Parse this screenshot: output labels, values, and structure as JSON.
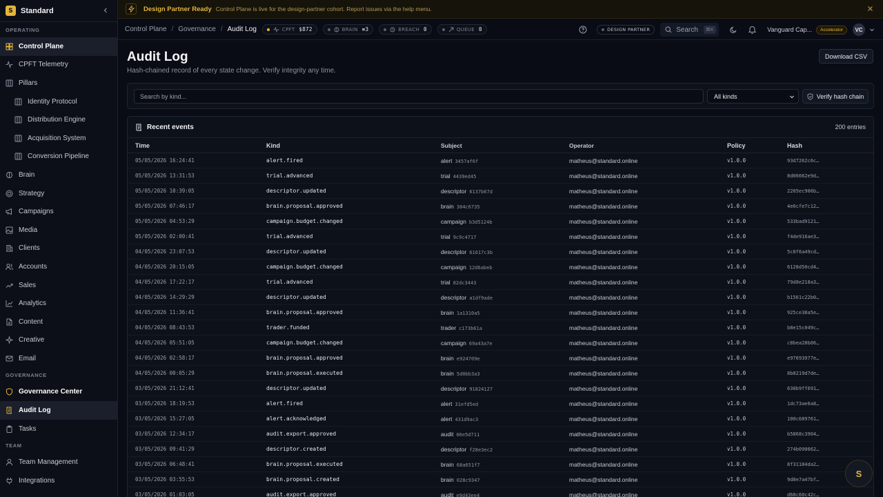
{
  "app": {
    "name": "Standard",
    "logo": "S"
  },
  "sidebar": {
    "sections": [
      {
        "label": "OPERATING",
        "items": [
          {
            "label": "Control Plane",
            "icon": "grid-icon",
            "active": true
          },
          {
            "label": "CPFT Telemetry",
            "icon": "activity-icon"
          },
          {
            "label": "Pillars",
            "icon": "columns-icon"
          },
          {
            "label": "Identity Protocol",
            "icon": "columns-icon",
            "sub": true
          },
          {
            "label": "Distribution Engine",
            "icon": "columns-icon",
            "sub": true
          },
          {
            "label": "Acquisition System",
            "icon": "columns-icon",
            "sub": true
          },
          {
            "label": "Conversion Pipeline",
            "icon": "columns-icon",
            "sub": true
          },
          {
            "label": "Brain",
            "icon": "brain-icon"
          },
          {
            "label": "Strategy",
            "icon": "target-icon"
          },
          {
            "label": "Campaigns",
            "icon": "megaphone-icon"
          },
          {
            "label": "Media",
            "icon": "image-icon"
          },
          {
            "label": "Clients",
            "icon": "building-icon"
          },
          {
            "label": "Accounts",
            "icon": "users-icon"
          },
          {
            "label": "Sales",
            "icon": "trending-icon"
          },
          {
            "label": "Analytics",
            "icon": "chart-icon"
          },
          {
            "label": "Content",
            "icon": "file-icon"
          },
          {
            "label": "Creative",
            "icon": "sparkle-icon"
          },
          {
            "label": "Email",
            "icon": "mail-icon"
          }
        ]
      },
      {
        "label": "GOVERNANCE",
        "items": [
          {
            "label": "Governance Center",
            "icon": "shield-icon",
            "active": true
          },
          {
            "label": "Audit Log",
            "icon": "scroll-icon",
            "active": true
          },
          {
            "label": "Tasks",
            "icon": "clipboard-icon"
          }
        ]
      },
      {
        "label": "TEAM",
        "items": [
          {
            "label": "Team Management",
            "icon": "user-icon"
          },
          {
            "label": "Integrations",
            "icon": "plug-icon"
          }
        ]
      }
    ]
  },
  "banner": {
    "title": "Design Partner Ready",
    "message": "Control Plane is live for the design-partner cohort. Report issues via the help menu."
  },
  "breadcrumb": [
    "Control Plane",
    "Governance",
    "Audit Log"
  ],
  "metrics": [
    {
      "label": "CPFT",
      "value": "$872"
    },
    {
      "label": "BRAIN",
      "value": "≡3"
    },
    {
      "label": "BREACH",
      "value": "0"
    },
    {
      "label": "QUEUE",
      "value": "0"
    }
  ],
  "topbar": {
    "badge": "DESIGN PARTNER",
    "search_label": "Search",
    "shortcut": "⌘K",
    "org": "Vanguard Cap...",
    "tier": "Accelerator",
    "avatar": "VC"
  },
  "page": {
    "title": "Audit Log",
    "subtitle": "Hash-chained record of every state change. Verify integrity any time.",
    "download": "Download CSV"
  },
  "filters": {
    "placeholder": "Search by kind...",
    "kind_value": "All kinds",
    "verify": "Verify hash chain"
  },
  "table": {
    "title": "Recent events",
    "count": "200 entries",
    "columns": [
      "Time",
      "Kind",
      "Subject",
      "Operator",
      "Policy",
      "Hash"
    ],
    "rows": [
      [
        "05/05/2026 16:24:41",
        "alert.fired",
        "alert",
        "3457af6f",
        "matheus@standard.online",
        "v1.0.0",
        "93d7262c6c…"
      ],
      [
        "05/05/2026 13:31:53",
        "trial.advanced",
        "trial",
        "4439ed45",
        "matheus@standard.online",
        "v1.0.0",
        "8d06662e9d…"
      ],
      [
        "05/05/2026 10:39:05",
        "descriptor.updated",
        "descriptor",
        "6137b67d",
        "matheus@standard.online",
        "v1.0.0",
        "2205ec906b…"
      ],
      [
        "05/05/2026 07:46:17",
        "brain.proposal.approved",
        "brain",
        "304c6735",
        "matheus@standard.online",
        "v1.0.0",
        "4e6cfe7c12…"
      ],
      [
        "05/05/2026 04:53:29",
        "campaign.budget.changed",
        "campaign",
        "b3d5124b",
        "matheus@standard.online",
        "v1.0.0",
        "533bad9121…"
      ],
      [
        "05/05/2026 02:00:41",
        "trial.advanced",
        "trial",
        "9c9c4717",
        "matheus@standard.online",
        "v1.0.0",
        "f4de916ae3…"
      ],
      [
        "04/05/2026 23:07:53",
        "descriptor.updated",
        "descriptor",
        "61617c3b",
        "matheus@standard.online",
        "v1.0.0",
        "5c8f6a49cd…"
      ],
      [
        "04/05/2026 20:15:05",
        "campaign.budget.changed",
        "campaign",
        "12d6abeb",
        "matheus@standard.online",
        "v1.0.0",
        "6128d50cd4…"
      ],
      [
        "04/05/2026 17:22:17",
        "trial.advanced",
        "trial",
        "82dc3443",
        "matheus@standard.online",
        "v1.0.0",
        "79d8e218a3…"
      ],
      [
        "04/05/2026 14:29:29",
        "descriptor.updated",
        "descriptor",
        "a1df9ade",
        "matheus@standard.online",
        "v1.0.0",
        "b1561c22b0…"
      ],
      [
        "04/05/2026 11:36:41",
        "brain.proposal.approved",
        "brain",
        "1a1310a5",
        "matheus@standard.online",
        "v1.0.0",
        "925ce38a5e…"
      ],
      [
        "04/05/2026 08:43:53",
        "trader.funded",
        "trader",
        "c173b61a",
        "matheus@standard.online",
        "v1.0.0",
        "b8e15c049c…"
      ],
      [
        "04/05/2026 05:51:05",
        "campaign.budget.changed",
        "campaign",
        "69a43a7e",
        "matheus@standard.online",
        "v1.0.0",
        "c8bea28b06…"
      ],
      [
        "04/05/2026 02:58:17",
        "brain.proposal.approved",
        "brain",
        "e924709e",
        "matheus@standard.online",
        "v1.0.0",
        "e97693977e…"
      ],
      [
        "04/05/2026 00:05:29",
        "brain.proposal.executed",
        "brain",
        "5d0bb3a3",
        "matheus@standard.online",
        "v1.0.0",
        "8b8219d7de…"
      ],
      [
        "03/05/2026 21:12:41",
        "descriptor.updated",
        "descriptor",
        "91824127",
        "matheus@standard.online",
        "v1.0.0",
        "630b9ff691…"
      ],
      [
        "03/05/2026 18:19:53",
        "alert.fired",
        "alert",
        "31efd5ed",
        "matheus@standard.online",
        "v1.0.0",
        "1dc73ae6a8…"
      ],
      [
        "03/05/2026 15:27:05",
        "alert.acknowledged",
        "alert",
        "431d9ac3",
        "matheus@standard.online",
        "v1.0.0",
        "100c689761…"
      ],
      [
        "03/05/2026 12:34:17",
        "audit.export.approved",
        "audit",
        "06e5d711",
        "matheus@standard.online",
        "v1.0.0",
        "b5868c3904…"
      ],
      [
        "03/05/2026 09:41:29",
        "descriptor.created",
        "descriptor",
        "f28e3ec2",
        "matheus@standard.online",
        "v1.0.0",
        "274b090662…"
      ],
      [
        "03/05/2026 06:48:41",
        "brain.proposal.executed",
        "brain",
        "68a651f7",
        "matheus@standard.online",
        "v1.0.0",
        "8f31184da2…"
      ],
      [
        "03/05/2026 03:55:53",
        "brain.proposal.created",
        "brain",
        "028c9347",
        "matheus@standard.online",
        "v1.0.0",
        "9d8e7a47bf…"
      ],
      [
        "03/05/2026 01:03:05",
        "audit.export.approved",
        "audit",
        "e9d43ee4",
        "matheus@standard.online",
        "v1.0.0",
        "d68c60c42c…"
      ]
    ]
  },
  "fab": {
    "label": "S"
  }
}
